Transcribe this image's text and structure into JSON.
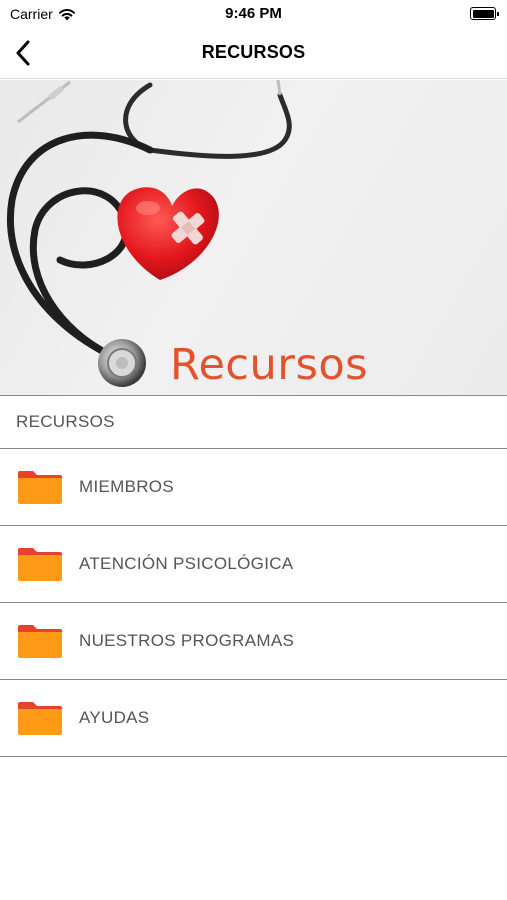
{
  "status_bar": {
    "carrier": "Carrier",
    "time": "9:46 PM"
  },
  "nav": {
    "title": "RECURSOS",
    "back_icon": "chevron-left-icon"
  },
  "banner": {
    "caption": "Recursos"
  },
  "list": {
    "section_header": "RECURSOS",
    "items": [
      {
        "label": "MIEMBROS",
        "icon": "folder-icon"
      },
      {
        "label": "ATENCIÓN PSICOLÓGICA",
        "icon": "folder-icon"
      },
      {
        "label": "NUESTROS PROGRAMAS",
        "icon": "folder-icon"
      },
      {
        "label": "AYUDAS",
        "icon": "folder-icon"
      }
    ]
  },
  "colors": {
    "folder_orange": "#ff9a16",
    "folder_tab_red": "#e8412c",
    "banner_text": "#e2532c",
    "divider": "#8a8a8a"
  }
}
